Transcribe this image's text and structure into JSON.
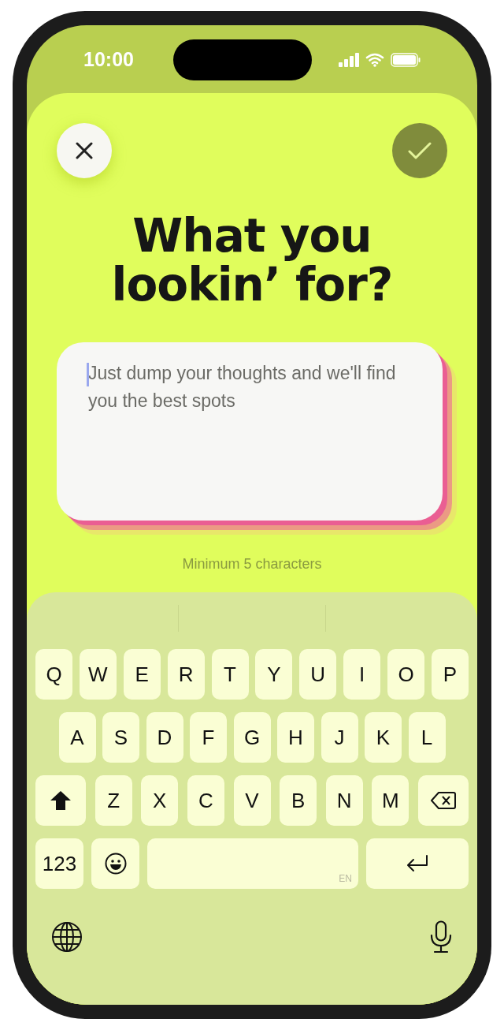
{
  "status_bar": {
    "time": "10:00"
  },
  "title": "What you lookin’ for?",
  "input": {
    "placeholder": "Just dump your thoughts and we'll find you the best spots",
    "focused": true
  },
  "hint": "Minimum 5 characters",
  "keyboard": {
    "rows": [
      [
        {
          "kind": "letter",
          "label": "Q"
        },
        {
          "kind": "letter",
          "label": "W"
        },
        {
          "kind": "letter",
          "label": "E"
        },
        {
          "kind": "letter",
          "label": "R"
        },
        {
          "kind": "letter",
          "label": "T"
        },
        {
          "kind": "letter",
          "label": "Y"
        },
        {
          "kind": "letter",
          "label": "U"
        },
        {
          "kind": "letter",
          "label": "I"
        },
        {
          "kind": "letter",
          "label": "O"
        },
        {
          "kind": "letter",
          "label": "P"
        }
      ],
      [
        {
          "kind": "letter",
          "label": "A"
        },
        {
          "kind": "letter",
          "label": "S"
        },
        {
          "kind": "letter",
          "label": "D"
        },
        {
          "kind": "letter",
          "label": "F"
        },
        {
          "kind": "letter",
          "label": "G"
        },
        {
          "kind": "letter",
          "label": "H"
        },
        {
          "kind": "letter",
          "label": "J"
        },
        {
          "kind": "letter",
          "label": "K"
        },
        {
          "kind": "letter",
          "label": "L"
        }
      ],
      [
        {
          "kind": "shift"
        },
        {
          "kind": "letter",
          "label": "Z"
        },
        {
          "kind": "letter",
          "label": "X"
        },
        {
          "kind": "letter",
          "label": "C"
        },
        {
          "kind": "letter",
          "label": "V"
        },
        {
          "kind": "letter",
          "label": "B"
        },
        {
          "kind": "letter",
          "label": "N"
        },
        {
          "kind": "letter",
          "label": "M"
        },
        {
          "kind": "backspace"
        }
      ],
      [
        {
          "kind": "numbers",
          "label": "123"
        },
        {
          "kind": "emoji"
        },
        {
          "kind": "space",
          "label": "EN"
        },
        {
          "kind": "return"
        }
      ]
    ]
  }
}
